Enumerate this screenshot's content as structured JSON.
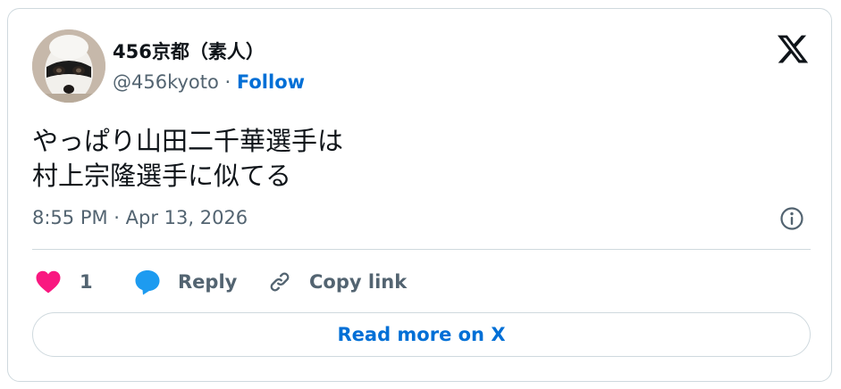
{
  "author": {
    "display_name": "456京都（素人）",
    "handle": "@456kyoto",
    "separator": " · ",
    "follow_label": "Follow"
  },
  "tweet": {
    "line1": "やっぱり山田二千華選手は",
    "line2": "村上宗隆選手に似てる",
    "timestamp": "8:55 PM · Apr 13, 2026"
  },
  "actions": {
    "like_count": "1",
    "reply_label": "Reply",
    "copy_link_label": "Copy link"
  },
  "read_more_label": "Read more on X",
  "icons": {
    "logo": "x-logo-icon",
    "info": "info-icon",
    "like": "heart-icon",
    "reply": "speech-bubble-icon",
    "copy": "link-icon"
  },
  "colors": {
    "accent": "#006fd6",
    "like": "#f91880",
    "reply": "#1d9bf0",
    "text": "#0f1419",
    "secondary": "#536471",
    "border": "#cfd9de"
  }
}
